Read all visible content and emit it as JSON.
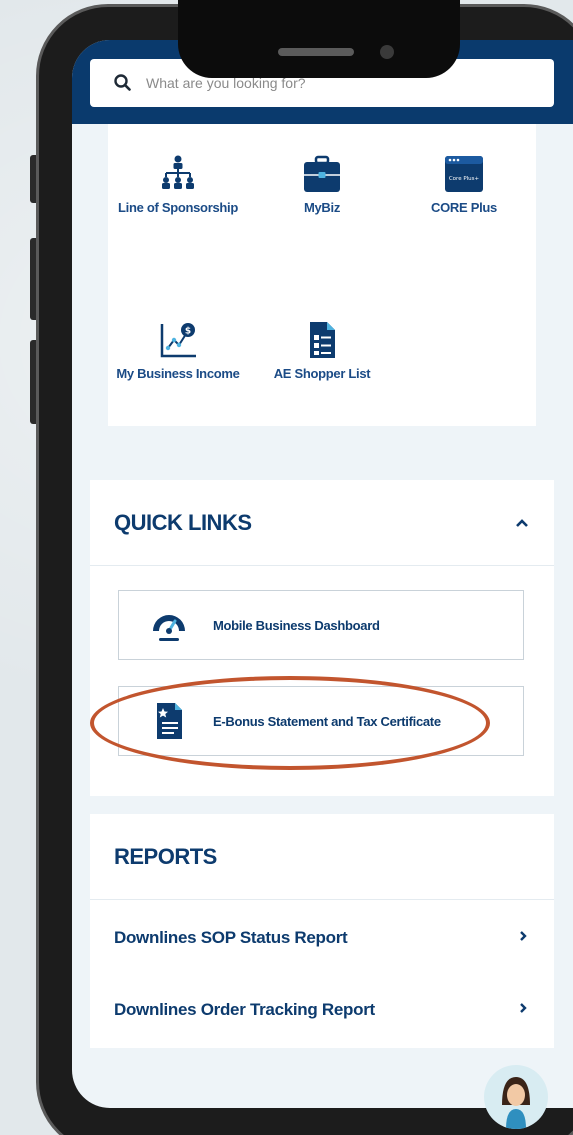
{
  "search": {
    "placeholder": "What are you looking for?"
  },
  "apps": [
    {
      "label": "Line of Sponsorship",
      "icon": "org-chart-icon"
    },
    {
      "label": "MyBiz",
      "icon": "briefcase-icon"
    },
    {
      "label": "CORE Plus",
      "icon": "core-plus-window-icon",
      "icon_text": "Core Plus+"
    },
    {
      "label": "My Business Income",
      "icon": "income-chart-icon"
    },
    {
      "label": "AE Shopper List",
      "icon": "shopper-list-icon"
    }
  ],
  "quick_links": {
    "title": "QUICK LINKS",
    "expanded": true,
    "items": [
      {
        "label": "Mobile Business Dashboard",
        "icon": "speedometer-icon"
      },
      {
        "label": "E-Bonus Statement and Tax Certificate",
        "icon": "document-star-icon",
        "highlighted": true
      }
    ]
  },
  "reports": {
    "title": "REPORTS",
    "items": [
      {
        "label": "Downlines SOP Status Report"
      },
      {
        "label": "Downlines Order Tracking Report"
      }
    ]
  },
  "colors": {
    "brand_navy": "#0a3a6d",
    "label_blue": "#1b4b86",
    "highlight": "#c2552e"
  }
}
